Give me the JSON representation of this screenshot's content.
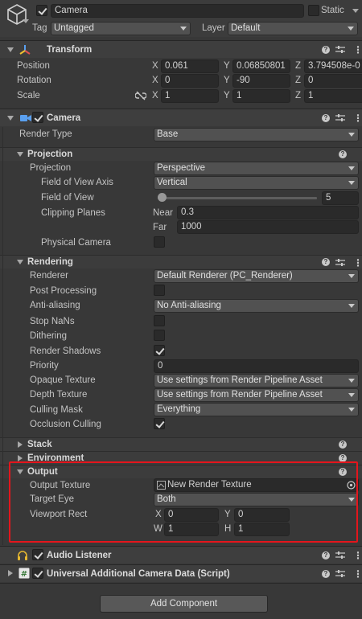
{
  "gameobject": {
    "name": "Camera",
    "static_label": "Static",
    "tag_label": "Tag",
    "tag_value": "Untagged",
    "layer_label": "Layer",
    "layer_value": "Default"
  },
  "transform": {
    "title": "Transform",
    "position_label": "Position",
    "rotation_label": "Rotation",
    "scale_label": "Scale",
    "position": {
      "x": "0.061",
      "y": "0.06850801",
      "z": "3.794508e-0"
    },
    "rotation": {
      "x": "0",
      "y": "-90",
      "z": "0"
    },
    "scale": {
      "x": "1",
      "y": "1",
      "z": "1"
    }
  },
  "axes": {
    "x": "X",
    "y": "Y",
    "z": "Z",
    "w": "W",
    "h": "H"
  },
  "camera": {
    "title": "Camera",
    "render_type_label": "Render Type",
    "render_type_value": "Base",
    "projection": {
      "section": "Projection",
      "projection_label": "Projection",
      "projection_value": "Perspective",
      "fov_axis_label": "Field of View Axis",
      "fov_axis_value": "Vertical",
      "fov_label": "Field of View",
      "fov_value": "5",
      "fov_fraction": 0.03,
      "clipping_label": "Clipping Planes",
      "near_label": "Near",
      "near_value": "0.3",
      "far_label": "Far",
      "far_value": "1000",
      "physical_label": "Physical Camera"
    },
    "rendering": {
      "section": "Rendering",
      "renderer_label": "Renderer",
      "renderer_value": "Default Renderer (PC_Renderer)",
      "post_processing_label": "Post Processing",
      "aa_label": "Anti-aliasing",
      "aa_value": "No Anti-aliasing",
      "stop_nans_label": "Stop NaNs",
      "dithering_label": "Dithering",
      "shadows_label": "Render Shadows",
      "priority_label": "Priority",
      "priority_value": "0",
      "opaque_label": "Opaque Texture",
      "opaque_value": "Use settings from Render Pipeline Asset",
      "depth_label": "Depth Texture",
      "depth_value": "Use settings from Render Pipeline Asset",
      "culling_label": "Culling Mask",
      "culling_value": "Everything",
      "occlusion_label": "Occlusion Culling"
    },
    "stack_section": "Stack",
    "environment_section": "Environment",
    "output": {
      "section": "Output",
      "texture_label": "Output Texture",
      "texture_value": "New Render Texture",
      "eye_label": "Target Eye",
      "eye_value": "Both",
      "viewport_label": "Viewport Rect",
      "x": "0",
      "y": "0",
      "w": "1",
      "h": "1"
    }
  },
  "audio_listener": {
    "title": "Audio Listener"
  },
  "uacd": {
    "title": "Universal Additional Camera Data (Script)"
  },
  "add_component_label": "Add Component",
  "colors": {
    "highlight": "#e4151c",
    "background": "#383838"
  }
}
